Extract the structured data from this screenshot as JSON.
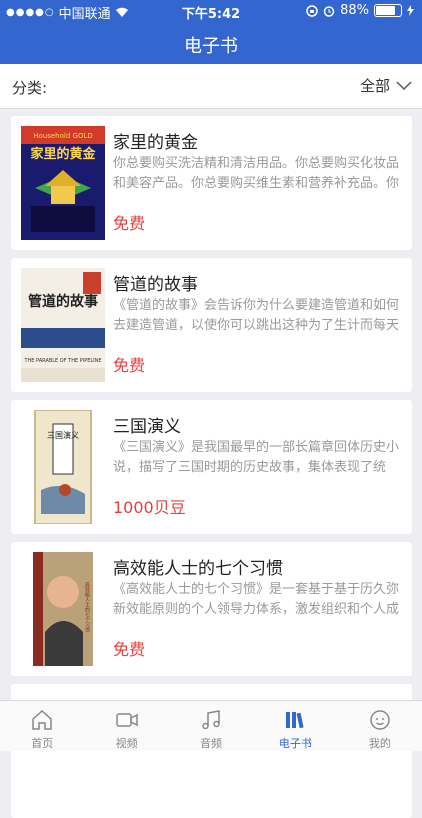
{
  "status_bar": {
    "carrier": "中国联通",
    "time": "下午5:42",
    "battery": "88%",
    "battery_level": 0.88
  },
  "header": {
    "title": "电子书"
  },
  "filter": {
    "label": "分类:",
    "selected": "全部"
  },
  "books": [
    {
      "title": "家里的黄金",
      "description": "你总要购买洗洁精和清洁用品。你总要购买化妆品和美容产品。你总要购买维生素和营养补充品。你总...",
      "price": "免费",
      "cover_text": "家里的黄金",
      "cover_top": "Household GOLD"
    },
    {
      "title": "管道的故事",
      "description": "《管道的故事》会告诉你为什么要建造管道和如何去建造管道，以使你可以跳出这种为了生计而每天必...",
      "price": "免费",
      "cover_text": "管道的故事",
      "cover_top": "THE PARABLE OF THE PIPELINE"
    },
    {
      "title": "三国演义",
      "description": "《三国演义》是我国最早的一部长篇章回体历史小说，描写了三国时期的历史故事，集体表现了统治...",
      "price": "1000贝豆",
      "cover_text": "三国演义"
    },
    {
      "title": "高效能人士的七个习惯",
      "description": "《高效能人士的七个习惯》是一套基于基于历久弥新效能原则的个人领导力体系，激发组织和个人成就...",
      "price": "免费",
      "cover_text": "高效能人士的七个习惯"
    }
  ],
  "tabs": [
    {
      "label": "首页",
      "icon": "home-icon"
    },
    {
      "label": "视频",
      "icon": "video-icon"
    },
    {
      "label": "音频",
      "icon": "music-icon"
    },
    {
      "label": "电子书",
      "icon": "ebook-icon"
    },
    {
      "label": "我的",
      "icon": "profile-icon"
    }
  ],
  "colors": {
    "primary": "#3367cf",
    "price": "#e44040"
  }
}
